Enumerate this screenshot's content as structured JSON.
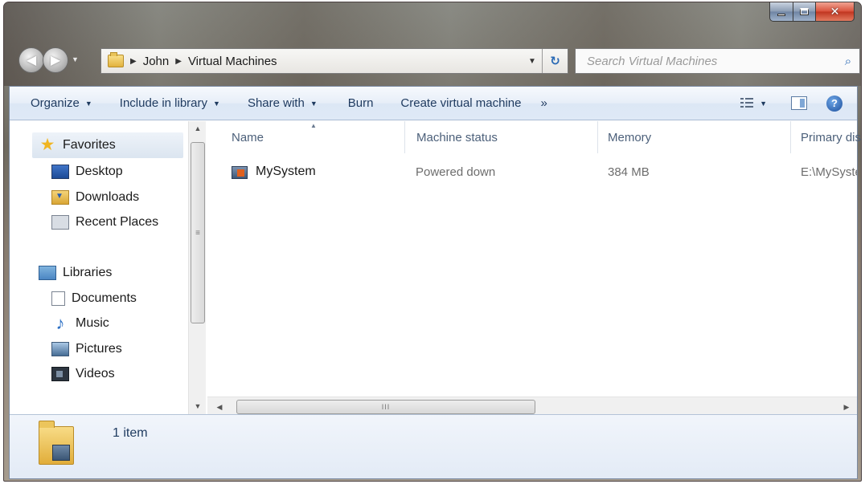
{
  "window": {
    "close_glyph": "✕"
  },
  "nav": {
    "back_glyph": "◀",
    "forward_glyph": "▶",
    "dropdown_glyph": "▼"
  },
  "address": {
    "breadcrumbs": [
      "John",
      "Virtual Machines"
    ],
    "separator": "▶",
    "dropdown_glyph": "▼",
    "refresh_glyph": "↻"
  },
  "search": {
    "placeholder": "Search Virtual Machines",
    "icon_glyph": "⌕"
  },
  "toolbar": {
    "organize": "Organize",
    "include_in_library": "Include in library",
    "share_with": "Share with",
    "burn": "Burn",
    "create_vm": "Create virtual machine",
    "more": "»",
    "dd": "▼",
    "help_glyph": "?"
  },
  "navpane": {
    "favorites": "Favorites",
    "desktop": "Desktop",
    "downloads": "Downloads",
    "recent_places": "Recent Places",
    "libraries": "Libraries",
    "documents": "Documents",
    "music": "Music",
    "pictures": "Pictures",
    "videos": "Videos",
    "star_glyph": "★",
    "music_glyph": "♪",
    "scroll_up": "▲",
    "scroll_down": "▼",
    "thumb_grip": "≡"
  },
  "columns": {
    "name": "Name",
    "status": "Machine status",
    "memory": "Memory",
    "disk": "Primary dis",
    "sort_glyph": "▲"
  },
  "files": [
    {
      "name": "MySystem",
      "status": "Powered down",
      "memory": "384 MB",
      "disk": "E:\\MySyste"
    }
  ],
  "hscroll": {
    "left": "◀",
    "right": "▶",
    "grip": "III"
  },
  "details": {
    "count": "1 item"
  },
  "colors": {
    "toolbar_text": "#1e3a5f",
    "header_text": "#4c607a",
    "link_blue": "#2a6ab5"
  }
}
